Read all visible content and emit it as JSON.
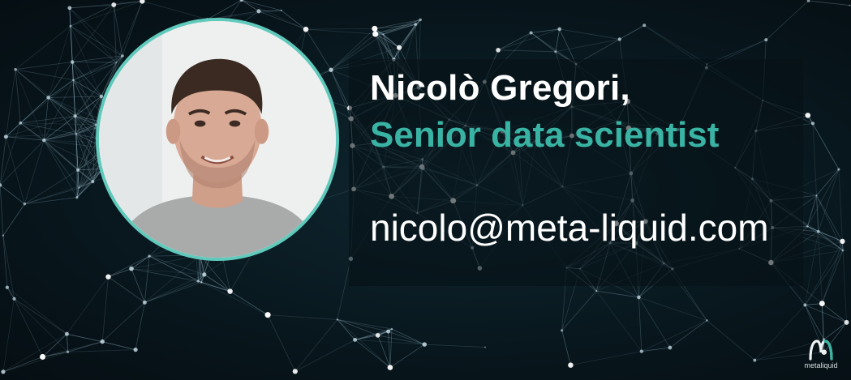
{
  "profile": {
    "name": "Nicolò Gregori,",
    "role": "Senior data scientist",
    "email": "nicolo@meta-liquid.com"
  },
  "brand": {
    "logo_text": "metaliquid",
    "accent_color": "#39b3a3",
    "frame_color": "#5fc9bb",
    "background_color": "#07141a"
  }
}
